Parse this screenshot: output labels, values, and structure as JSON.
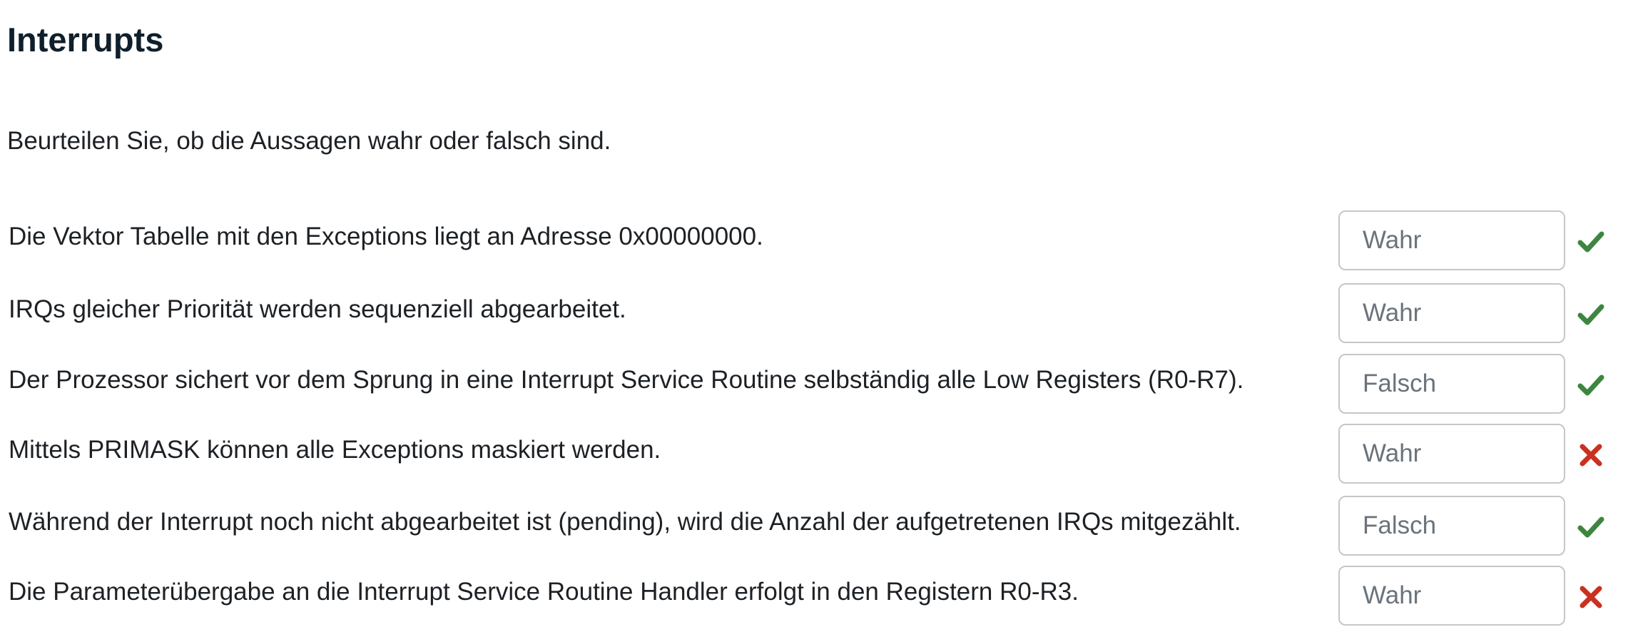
{
  "heading": "Interrupts",
  "instruction": "Beurteilen Sie, ob die Aussagen wahr oder falsch sind.",
  "colors": {
    "correct": "#3e8540",
    "incorrect": "#ca3120"
  },
  "questions": [
    {
      "statement": " Die Vektor Tabelle mit den Exceptions liegt an Adresse 0x00000000.",
      "answer": "Wahr",
      "result_icon": "check-icon"
    },
    {
      "statement": "IRQs gleicher Priorität werden sequenziell abgearbeitet.",
      "answer": "Wahr",
      "result_icon": "check-icon"
    },
    {
      "statement": "Der Prozessor sichert vor dem Sprung in eine Interrupt Service Routine selbständig alle Low Registers (R0-R7).",
      "answer": "Falsch",
      "result_icon": "check-icon"
    },
    {
      "statement": "Mittels PRIMASK können alle Exceptions maskiert werden.",
      "answer": "Wahr",
      "result_icon": "cross-icon"
    },
    {
      "statement": "Während der Interrupt noch nicht abgearbeitet ist (pending), wird die Anzahl der aufgetretenen IRQs mitgezählt.",
      "answer": "Falsch",
      "result_icon": "check-icon"
    },
    {
      "statement": "Die Parameterübergabe an die Interrupt Service Routine Handler erfolgt in den Registern R0-R3.",
      "answer": "Wahr",
      "result_icon": "cross-icon"
    }
  ]
}
